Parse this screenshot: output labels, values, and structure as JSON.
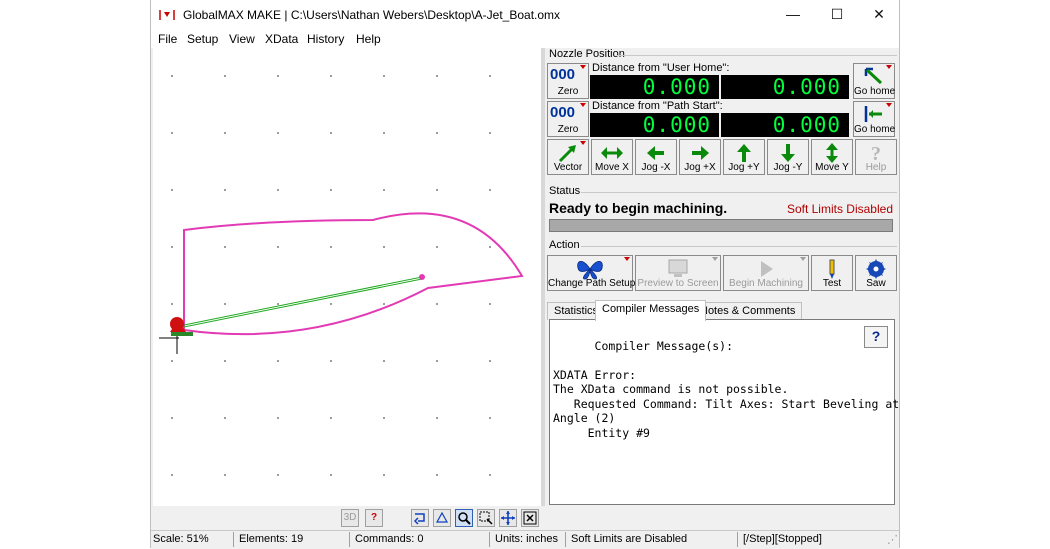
{
  "window": {
    "title": "GlobalMAX MAKE | C:\\Users\\Nathan Webers\\Desktop\\A-Jet_Boat.omx",
    "controls": {
      "minimize": "—",
      "maximize": "☐",
      "close": "✕"
    }
  },
  "menu": [
    {
      "label": "File"
    },
    {
      "label": "Setup"
    },
    {
      "label": "View"
    },
    {
      "label": "XData"
    },
    {
      "label": "History"
    },
    {
      "label": "Help"
    }
  ],
  "nozzle": {
    "group_label": "Nozzle Position",
    "user_home_label": "Distance from \"User Home\":",
    "path_start_label": "Distance from \"Path Start\":",
    "user_home_x": "0.000",
    "user_home_y": "0.000",
    "path_start_x": "0.000",
    "path_start_y": "0.000",
    "zero_icon_text": "000",
    "zero_label": "Zero",
    "go_home_label": "Go home"
  },
  "jog_buttons": [
    {
      "label": "Vector"
    },
    {
      "label": "Move X"
    },
    {
      "label": "Jog -X"
    },
    {
      "label": "Jog +X"
    },
    {
      "label": "Jog +Y"
    },
    {
      "label": "Jog -Y"
    },
    {
      "label": "Move Y"
    },
    {
      "label": "Help"
    }
  ],
  "status": {
    "group_label": "Status",
    "message": "Ready to begin machining.",
    "soft_limits": "Soft Limits Disabled"
  },
  "action": {
    "group_label": "Action",
    "buttons": [
      {
        "label": "Change Path Setup"
      },
      {
        "label": "Preview to Screen"
      },
      {
        "label": "Begin Machining"
      },
      {
        "label": "Test"
      },
      {
        "label": "Saw"
      }
    ]
  },
  "tabs": [
    {
      "label": "Statistics"
    },
    {
      "label": "Compiler Messages"
    },
    {
      "label": "Notes & Comments"
    }
  ],
  "compiler": {
    "text": "Compiler Message(s):\n\nXDATA Error:\nThe XData command is not possible.\n   Requested Command: Tilt Axes: Start Beveling at\nAngle (2)\n     Entity #9",
    "help_button": "?"
  },
  "bottom_toolbar": {
    "btn_3d": "3D",
    "help": "?"
  },
  "statusbar": {
    "scale": "Scale: 51%",
    "elements": "Elements: 19",
    "commands": "Commands: 0",
    "units": "Units: inches",
    "soft_limits": "Soft Limits are Disabled",
    "state": "[/Step][Stopped]"
  },
  "colors": {
    "lcd_text": "#00ff3c",
    "path": "#e23ab4",
    "lead": "#22aa22",
    "soft_limits_text": "#b00000"
  }
}
